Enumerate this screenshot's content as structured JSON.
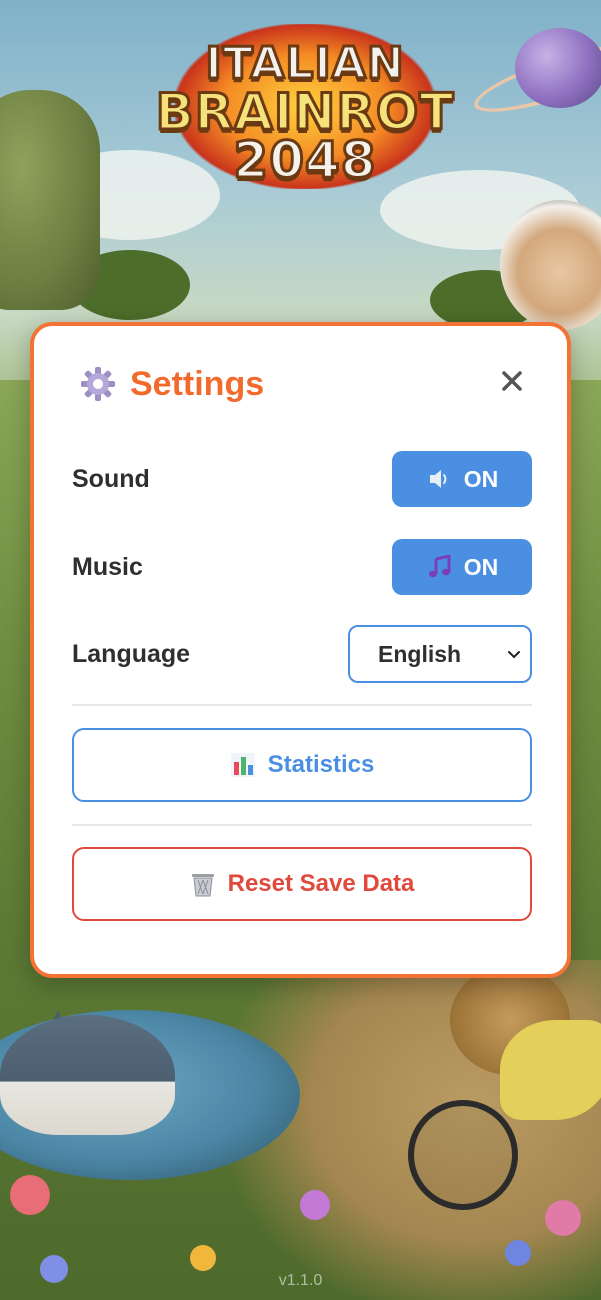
{
  "background": {
    "logo": {
      "line1": "ITALIAN",
      "line2": "BRAINROT",
      "line3": "2048"
    },
    "version": "v1.1.0"
  },
  "settings": {
    "title": "Settings",
    "icon": "gear-icon",
    "close_icon": "close-icon",
    "sound": {
      "label": "Sound",
      "state": "ON",
      "icon": "speaker-icon"
    },
    "music": {
      "label": "Music",
      "state": "ON",
      "icon": "music-note-icon"
    },
    "language": {
      "label": "Language",
      "selected": "English",
      "icon": "chevron-down-icon"
    },
    "statistics_button": {
      "label": "Statistics",
      "icon": "bar-chart-icon"
    },
    "reset_button": {
      "label": "Reset Save Data",
      "icon": "trash-icon"
    }
  },
  "colors": {
    "accent_orange": "#f37335",
    "toggle_blue": "#4a8fe2",
    "danger_red": "#e0493b",
    "panel_bg": "#ffffff"
  }
}
